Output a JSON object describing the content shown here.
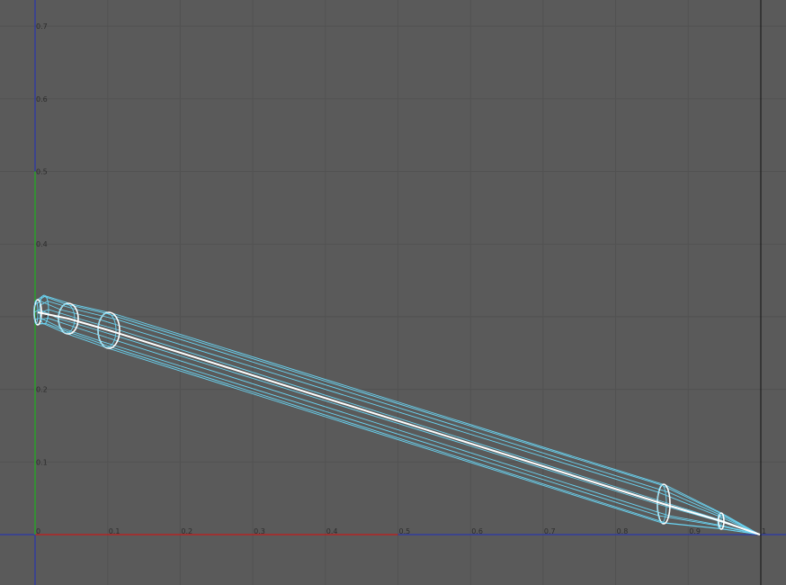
{
  "viewport": {
    "background": "#5a5a5a",
    "grid_color": "#525252",
    "x_axis_color": "#c41a1a",
    "y_axis_color": "#1fb21f",
    "origin_line_color": "#1f2fbf",
    "frame_line_color": "#111111",
    "wire_color": "#6ad4f2",
    "selected_wire_color": "#ffffff"
  },
  "axes": {
    "x_ticks": [
      "0",
      "0.1",
      "0.2",
      "0.3",
      "0.4",
      "0.5",
      "0.6",
      "0.7",
      "0.8",
      "0.9",
      "1"
    ],
    "y_ticks": [
      "0.1",
      "0.2",
      "0.3",
      "0.4",
      "0.5",
      "0.6",
      "0.7"
    ],
    "x_range": [
      0,
      1
    ],
    "y_range": [
      0,
      0.7
    ]
  },
  "model": {
    "name": "pencil-wireframe",
    "selected": true
  }
}
